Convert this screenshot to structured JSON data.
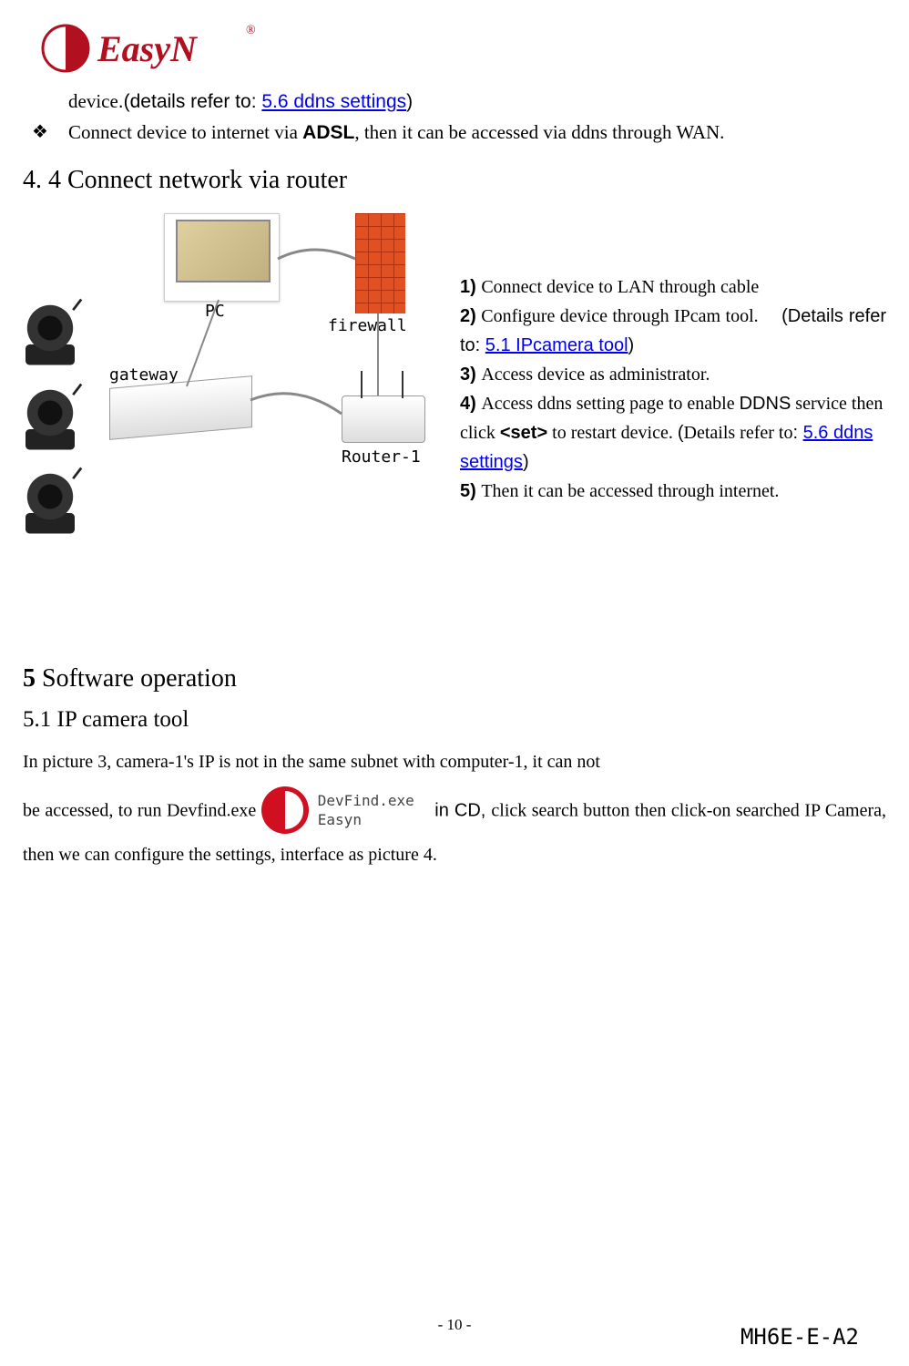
{
  "logo": {
    "brand": "EasyN",
    "reg": "®"
  },
  "topline": {
    "prefix": "device",
    "details_prefix": ".(details refer to: ",
    "link_text": "5.6 ddns settings",
    "suffix": ")"
  },
  "bullet2": {
    "pre": "Connect device to internet via ",
    "adsl": "ADSL",
    "post": ", then it can be accessed via ddns through WAN."
  },
  "sec44_heading": "4. 4  Connect network via router",
  "diagram": {
    "pc": "PC",
    "firewall": "firewall",
    "gateway": "gateway",
    "router": "Router-1"
  },
  "steps": {
    "s1": "Connect device to LAN through cable",
    "s2_pre": "Configure device through IPcam tool.",
    "s2_details_prefix": "(Details refer to: ",
    "s2_link": "5.1 IPcamera tool",
    "s2_suffix": ")",
    "s3": "Access device as administrator.",
    "s4_pre": "Access ddns setting page to enable ",
    "s4_ddns": "DDNS",
    "s4_mid": " service then click ",
    "s4_set": "<set>",
    "s4_post": " to restart device. ",
    "s4_details_prefix": "(",
    "s4_details_text": "Details refer to",
    "s4_details_colon": ": ",
    "s4_link": "5.6 ddns settings",
    "s4_suffix": ")",
    "s5": "Then it can be accessed through internet."
  },
  "sec5_heading_num": "5",
  "sec5_heading_text": " Software operation",
  "sec51_heading": "5.1 IP camera tool",
  "para51": {
    "line1": "In picture 3, camera-1's IP is not in the same subnet with computer-1, it can not",
    "line2_pre": "be accessed, to run Devfind.exe ",
    "devfind_text_1": "DevFind.exe",
    "devfind_text_2": "Easyn",
    "line2_mid": " in CD, ",
    "line2_post": "click search button then click-on searched IP Camera, then we can configure the settings, interface as picture 4."
  },
  "page_number": "- 10 -",
  "doc_code": "MH6E-E-A2"
}
